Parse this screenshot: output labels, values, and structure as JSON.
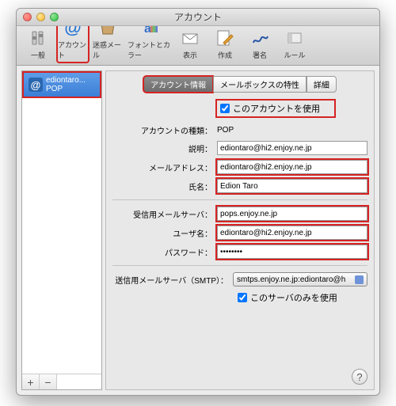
{
  "window": {
    "title": "アカウント"
  },
  "toolbar": {
    "items": [
      {
        "label": "一般"
      },
      {
        "label": "アカウント"
      },
      {
        "label": "迷惑メール"
      },
      {
        "label": "フォントとカラー"
      },
      {
        "label": "表示"
      },
      {
        "label": "作成"
      },
      {
        "label": "署名"
      },
      {
        "label": "ルール"
      }
    ]
  },
  "sidebar": {
    "account_name": "ediontaro...",
    "account_type": "POP",
    "add": "+",
    "remove": "−"
  },
  "tabs": {
    "info": "アカウント情報",
    "mailbox": "メールボックスの特性",
    "advanced": "詳細"
  },
  "form": {
    "use_account_label": "このアカウントを使用",
    "account_type_label": "アカウントの種類：",
    "account_type_value": "POP",
    "description_label": "説明：",
    "description_value": "ediontaro@hi2.enjoy.ne.jp",
    "email_label": "メールアドレス：",
    "email_value": "ediontaro@hi2.enjoy.ne.jp",
    "fullname_label": "氏名：",
    "fullname_value": "Edion Taro",
    "incoming_label": "受信用メールサーバ：",
    "incoming_value": "pops.enjoy.ne.jp",
    "username_label": "ユーザ名：",
    "username_value": "ediontaro@hi2.enjoy.ne.jp",
    "password_label": "パスワード：",
    "password_value": "••••••••",
    "smtp_label": "送信用メールサーバ（SMTP）：",
    "smtp_value": "smtps.enjoy.ne.jp:ediontaro@h",
    "smtp_only_label": "このサーバのみを使用"
  },
  "help": "?"
}
